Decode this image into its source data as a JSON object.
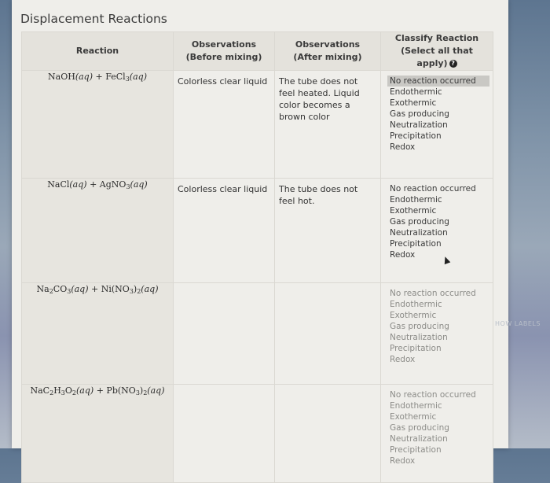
{
  "page": {
    "title": "Displacement Reactions",
    "side_label": "HOW LABELS"
  },
  "table": {
    "headers": {
      "reaction": "Reaction",
      "before_line1": "Observations",
      "before_line2": "(Before mixing)",
      "after_line1": "Observations",
      "after_line2": "(After mixing)",
      "classify_line1": "Classify Reaction",
      "classify_line2": "(Select all that apply)",
      "help_icon": "?"
    },
    "options": [
      "No reaction occurred",
      "Endothermic",
      "Exothermic",
      "Gas producing",
      "Neutralization",
      "Precipitation",
      "Redox"
    ],
    "rows": [
      {
        "reaction": {
          "a": "NaOH",
          "b": "FeCl",
          "b_sub": "3",
          "plus": "+",
          "aq": "(aq)"
        },
        "before": "Colorless clear liquid",
        "after": "The tube does not feel heated. Liquid color becomes a brown color",
        "selected": [
          "No reaction occurred"
        ]
      },
      {
        "reaction": {
          "a": "NaCl",
          "b": "AgNO",
          "b_sub": "3",
          "plus": "+",
          "aq": "(aq)"
        },
        "before": "Colorless clear liquid",
        "after": "The tube does not feel hot.",
        "selected": []
      },
      {
        "reaction": {
          "a": "Na",
          "a_sub": "2",
          "a2": "CO",
          "a2_sub": "3",
          "b": "Ni(NO",
          "b_sub": "3",
          "b2": ")",
          "b2_sub": "2",
          "plus": "+",
          "aq": "(aq)"
        },
        "before": "",
        "after": "",
        "selected": []
      },
      {
        "reaction": {
          "a": "NaC",
          "a_sub": "2",
          "a2": "H",
          "a2_sub": "3",
          "a3": "O",
          "a3_sub": "2",
          "b": "Pb(NO",
          "b_sub": "3",
          "b2": ")",
          "b2_sub": "2",
          "plus": "+",
          "aq": "(aq)"
        },
        "before": "",
        "after": "",
        "selected": []
      }
    ]
  }
}
